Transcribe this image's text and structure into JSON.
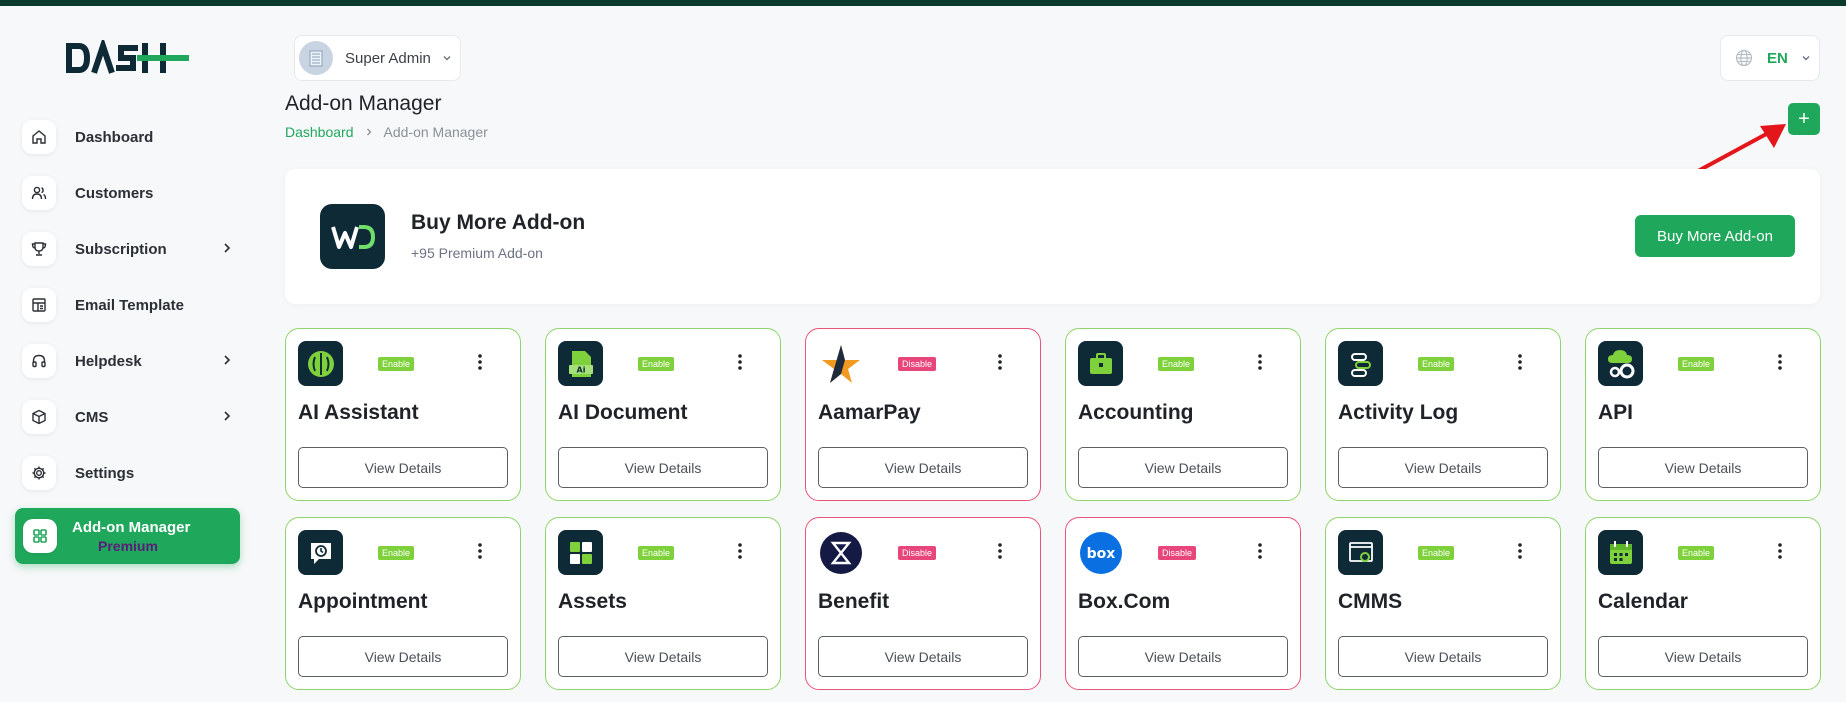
{
  "app": {
    "brand": "DASH"
  },
  "sidebar": {
    "items": [
      {
        "label": "Dashboard",
        "icon": "home-icon"
      },
      {
        "label": "Customers",
        "icon": "users-icon"
      },
      {
        "label": "Subscription",
        "icon": "trophy-icon",
        "has_submenu": true
      },
      {
        "label": "Email Template",
        "icon": "template-icon"
      },
      {
        "label": "Helpdesk",
        "icon": "headset-icon",
        "has_submenu": true
      },
      {
        "label": "CMS",
        "icon": "cube-icon",
        "has_submenu": true
      },
      {
        "label": "Settings",
        "icon": "gear-icon"
      }
    ],
    "active": {
      "label": "Add-on Manager",
      "badge": "Premium",
      "icon": "apps-icon"
    }
  },
  "header": {
    "user": "Super Admin",
    "language": "EN"
  },
  "page": {
    "title": "Add-on Manager",
    "breadcrumb": [
      "Dashboard",
      "Add-on Manager"
    ],
    "add_button": "+"
  },
  "banner": {
    "title": "Buy More Add-on",
    "subtitle": "+95 Premium Add-on",
    "button": "Buy More Add-on"
  },
  "addons": [
    {
      "name": "AI Assistant",
      "status": "Enable",
      "button": "View Details"
    },
    {
      "name": "AI Document",
      "status": "Enable",
      "button": "View Details"
    },
    {
      "name": "AamarPay",
      "status": "Disable",
      "button": "View Details"
    },
    {
      "name": "Accounting",
      "status": "Enable",
      "button": "View Details"
    },
    {
      "name": "Activity Log",
      "status": "Enable",
      "button": "View Details"
    },
    {
      "name": "API",
      "status": "Enable",
      "button": "View Details"
    },
    {
      "name": "Appointment",
      "status": "Enable",
      "button": "View Details"
    },
    {
      "name": "Assets",
      "status": "Enable",
      "button": "View Details"
    },
    {
      "name": "Benefit",
      "status": "Disable",
      "button": "View Details"
    },
    {
      "name": "Box.Com",
      "status": "Disable",
      "button": "View Details"
    },
    {
      "name": "CMMS",
      "status": "Enable",
      "button": "View Details"
    },
    {
      "name": "Calendar",
      "status": "Enable",
      "button": "View Details"
    }
  ],
  "colors": {
    "accent": "#1fa85c",
    "enable": "#7fd13b",
    "disable": "#e8457a",
    "topbar": "#0b3b2c"
  }
}
